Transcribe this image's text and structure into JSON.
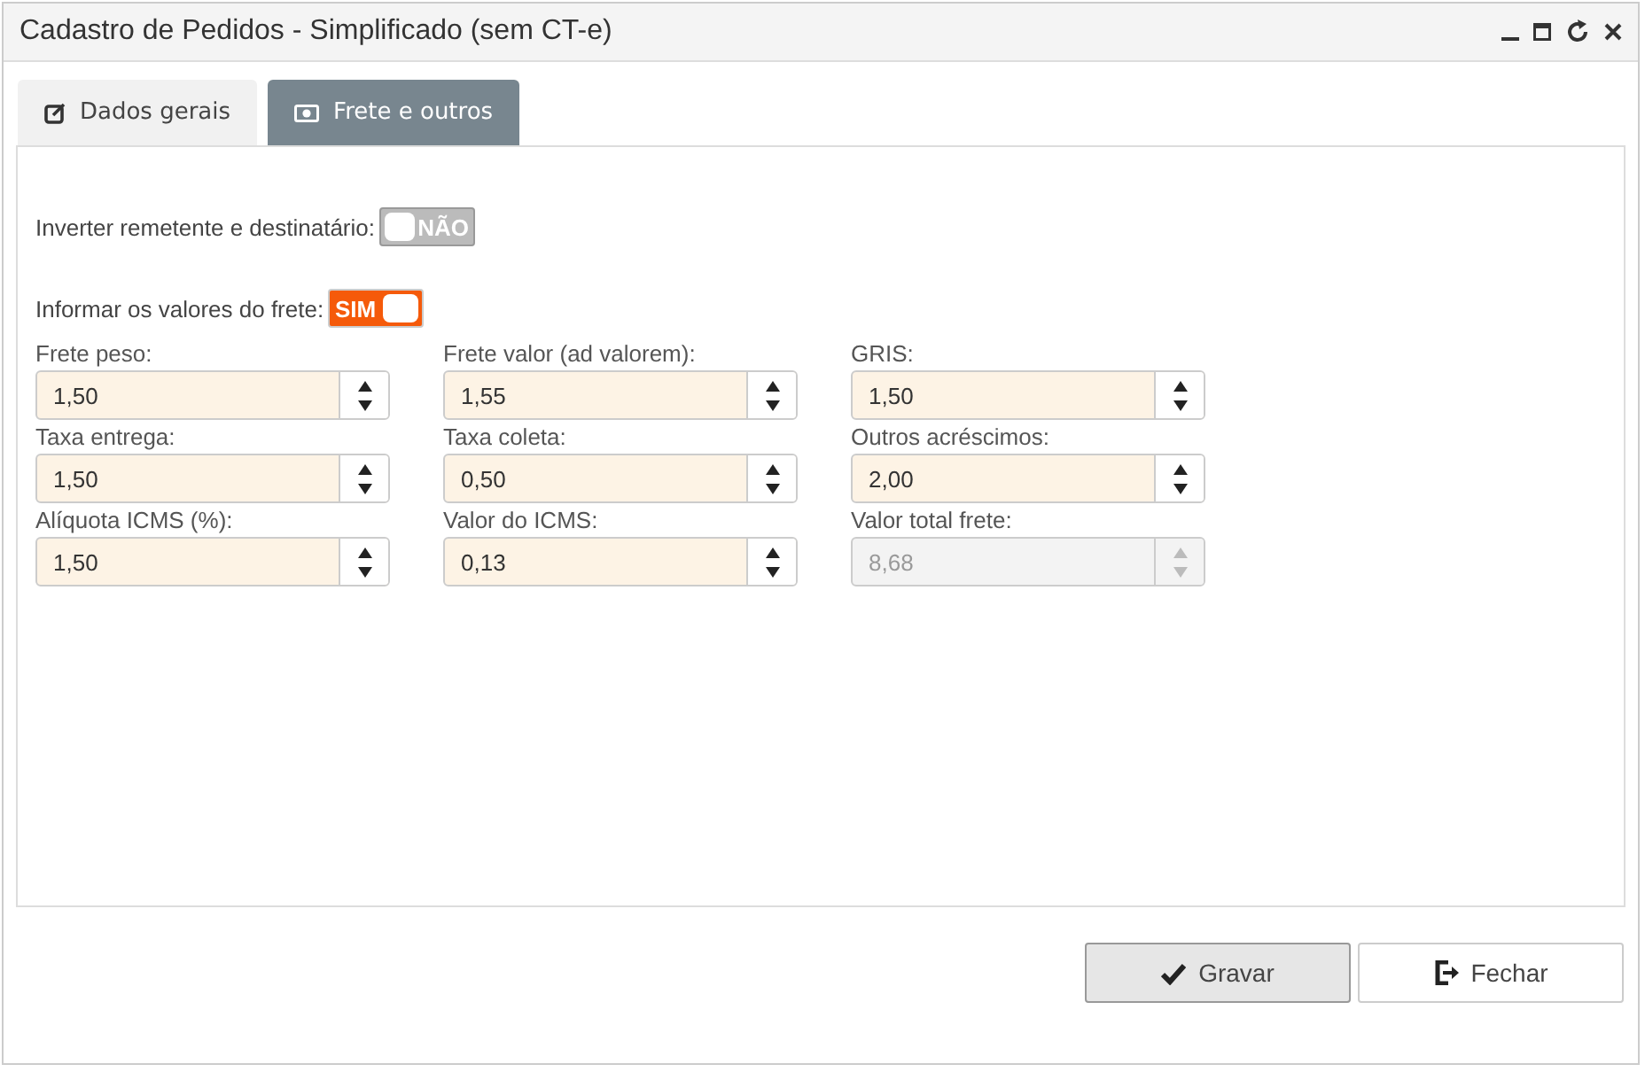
{
  "window": {
    "title": "Cadastro de Pedidos - Simplificado (sem CT-e)"
  },
  "tabs": [
    {
      "label": "Dados gerais",
      "selected": false,
      "kind": "edit"
    },
    {
      "label": "Frete e outros",
      "selected": true,
      "kind": "money"
    }
  ],
  "toggles": [
    {
      "label": "Inverter remetente e destinatário:",
      "text": "NÃO",
      "on": false
    },
    {
      "label": "Informar os valores do frete:",
      "text": "SIM",
      "on": true
    }
  ],
  "fields": [
    {
      "label": "Frete peso:",
      "value": "1,50",
      "disabled": false
    },
    {
      "label": "Frete valor (ad valorem):",
      "value": "1,55",
      "disabled": false
    },
    {
      "label": "GRIS:",
      "value": "1,50",
      "disabled": false
    },
    {
      "label": "Taxa entrega:",
      "value": "1,50",
      "disabled": false
    },
    {
      "label": "Taxa coleta:",
      "value": "0,50",
      "disabled": false
    },
    {
      "label": "Outros acréscimos:",
      "value": "2,00",
      "disabled": false
    },
    {
      "label": "Alíquota ICMS (%):",
      "value": "1,50",
      "disabled": false
    },
    {
      "label": "Valor do ICMS:",
      "value": "0,13",
      "disabled": false
    },
    {
      "label": "Valor total frete:",
      "value": "8,68",
      "disabled": true
    }
  ],
  "buttons": [
    {
      "label": "Gravar",
      "kind": "save"
    },
    {
      "label": "Fechar",
      "kind": "close"
    }
  ]
}
